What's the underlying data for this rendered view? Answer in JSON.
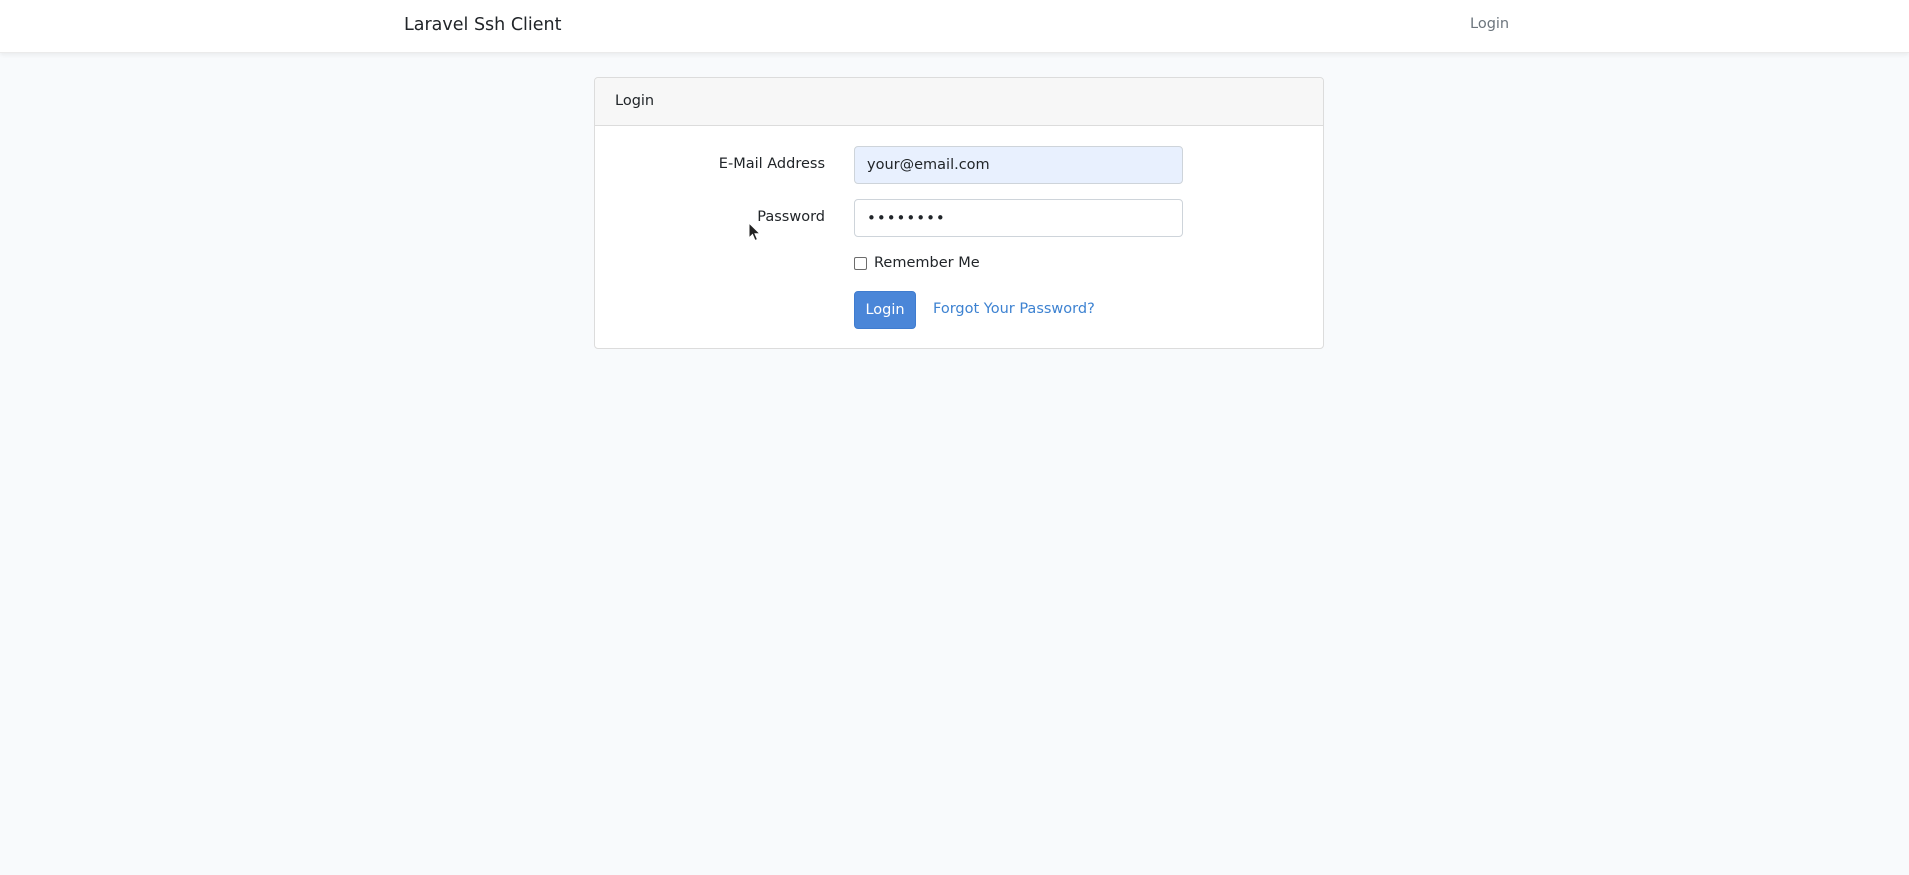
{
  "navbar": {
    "brand": "Laravel Ssh Client",
    "login_link": "Login"
  },
  "card": {
    "header_title": "Login",
    "email": {
      "label": "E-Mail Address",
      "value": "your@email.com"
    },
    "password": {
      "label": "Password",
      "value": "••••••••"
    },
    "remember": {
      "label": "Remember Me",
      "checked": false
    },
    "submit_label": "Login",
    "forgot_link": "Forgot Your Password?"
  },
  "colors": {
    "page_bg": "#f8fafc",
    "primary": "#4a86d8",
    "link": "#3d82d1",
    "autofill_bg": "#e8f0fe"
  },
  "icons": {
    "cursor": "mouse-pointer-icon"
  }
}
